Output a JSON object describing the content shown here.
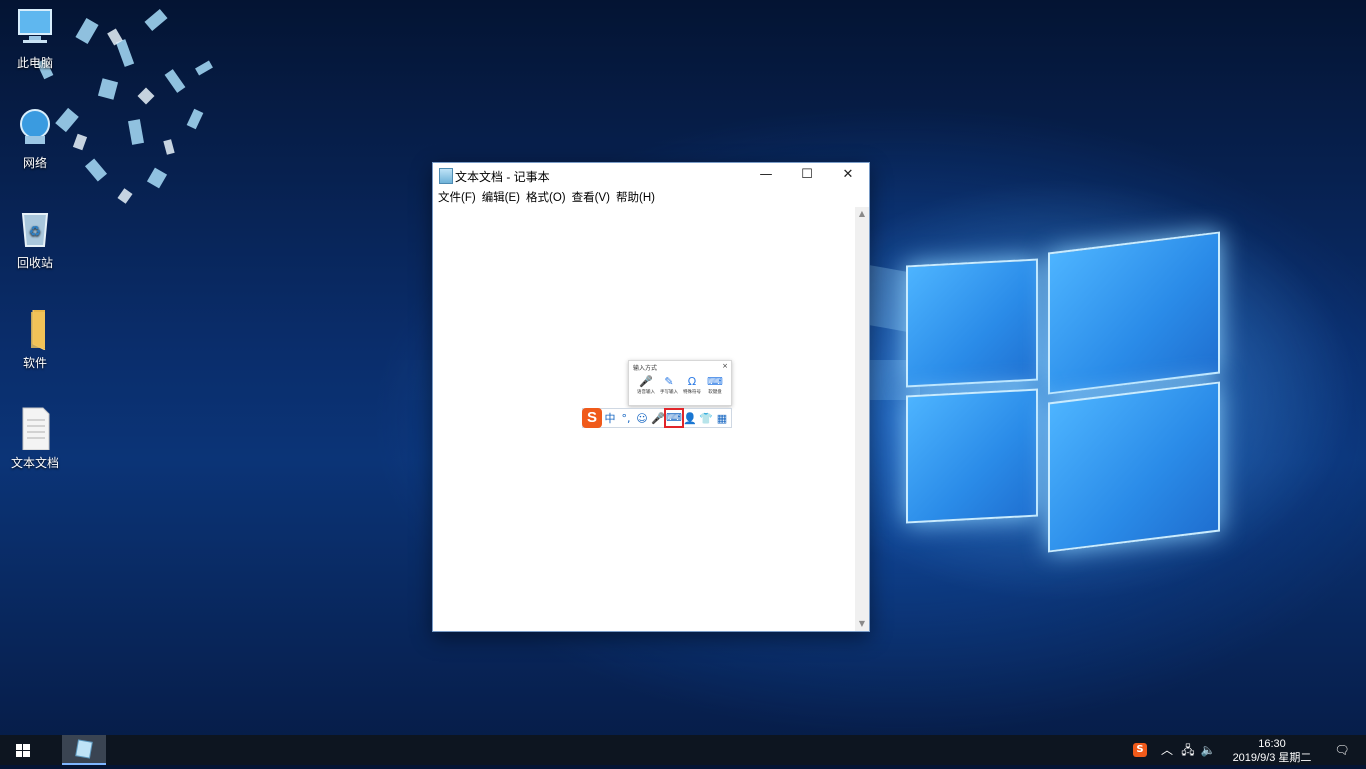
{
  "desktop": {
    "icons": [
      {
        "label": "此电脑",
        "icon": "computer-icon"
      },
      {
        "label": "网络",
        "icon": "network-icon"
      },
      {
        "label": "回收站",
        "icon": "recycle-bin-icon"
      },
      {
        "label": "软件",
        "icon": "folder-icon"
      },
      {
        "label": "文本文档",
        "icon": "text-document-icon"
      }
    ]
  },
  "notepad": {
    "title": "文本文档 - 记事本",
    "menu": [
      "文件(F)",
      "编辑(E)",
      "格式(O)",
      "查看(V)",
      "帮助(H)"
    ],
    "buttons": {
      "minimize": "—",
      "maximize": "☐",
      "close": "✕"
    }
  },
  "ime": {
    "popup_title": "输入方式",
    "options": [
      {
        "label": "语音输入",
        "icon": "microphone-icon",
        "glyph": "🎤"
      },
      {
        "label": "手写输入",
        "icon": "pen-icon",
        "glyph": "✎"
      },
      {
        "label": "特殊符号",
        "icon": "omega-icon",
        "glyph": "Ω"
      },
      {
        "label": "软键盘",
        "icon": "soft-keyboard-icon",
        "glyph": "⌨"
      }
    ],
    "toolbar": {
      "logo": "S",
      "lang": "中",
      "punct": "°,"
    }
  },
  "taskbar": {
    "time": "16:30",
    "date": "2019/9/3 星期二"
  }
}
